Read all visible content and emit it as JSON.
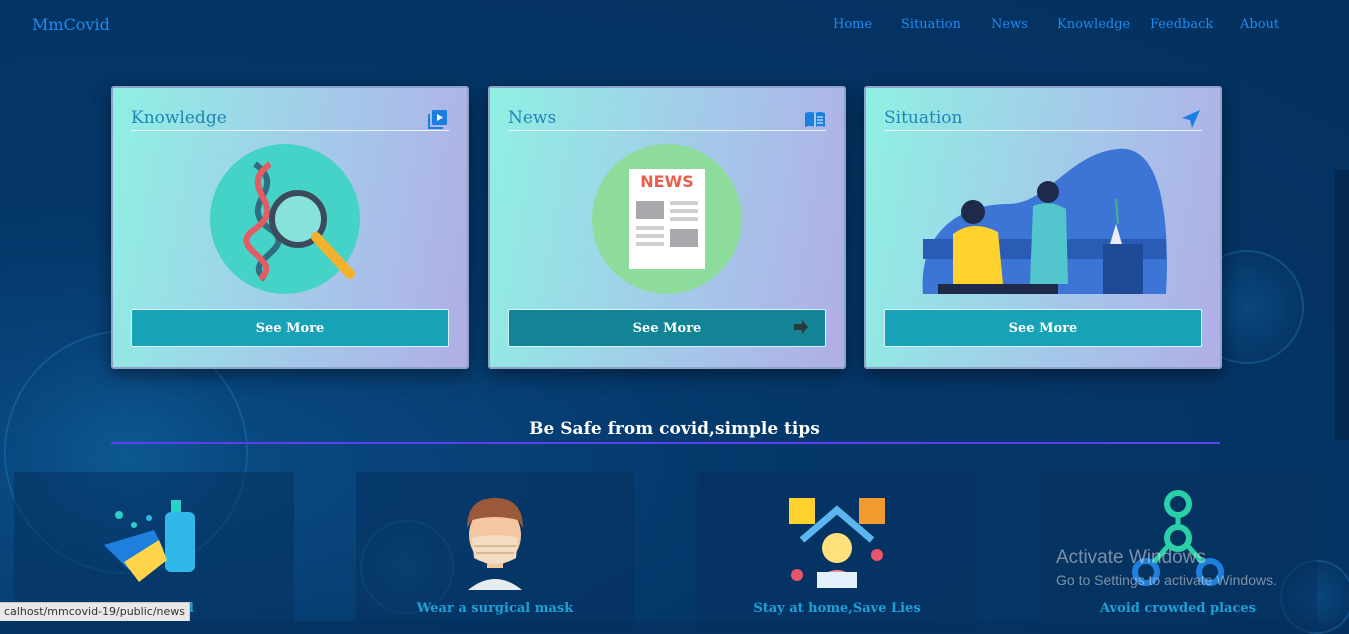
{
  "nav": {
    "brand": "MmCovid",
    "items": [
      "Home",
      "Situation",
      "News",
      "Knowledge",
      "Feedback",
      "About"
    ]
  },
  "cards": [
    {
      "title": "Knowledge",
      "icon": "play-book-icon",
      "button": "See More"
    },
    {
      "title": "News",
      "icon": "open-book-icon",
      "button": "See More",
      "newspaper_label": "NEWS"
    },
    {
      "title": "Situation",
      "icon": "location-arrow-icon",
      "button": "See More"
    }
  ],
  "tips": {
    "heading": "Be Safe from covid,simple tips",
    "items": [
      {
        "label": "Wash hand",
        "icon": "hand-wash-icon"
      },
      {
        "label": "Wear a surgical mask",
        "icon": "masked-person-icon"
      },
      {
        "label": "Stay at home,Save Lies",
        "icon": "stay-home-icon"
      },
      {
        "label": "Avoid crowded places",
        "icon": "crowd-icon"
      }
    ]
  },
  "status_bar": {
    "url": "calhost/mmcovid-19/public/news"
  },
  "watermark": {
    "title": "Activate Windows",
    "subtitle": "Go to Settings to activate Windows."
  },
  "colors": {
    "accent": "#1e8bf0",
    "button": "#17a2b8",
    "divider": "#5b3ff0"
  }
}
